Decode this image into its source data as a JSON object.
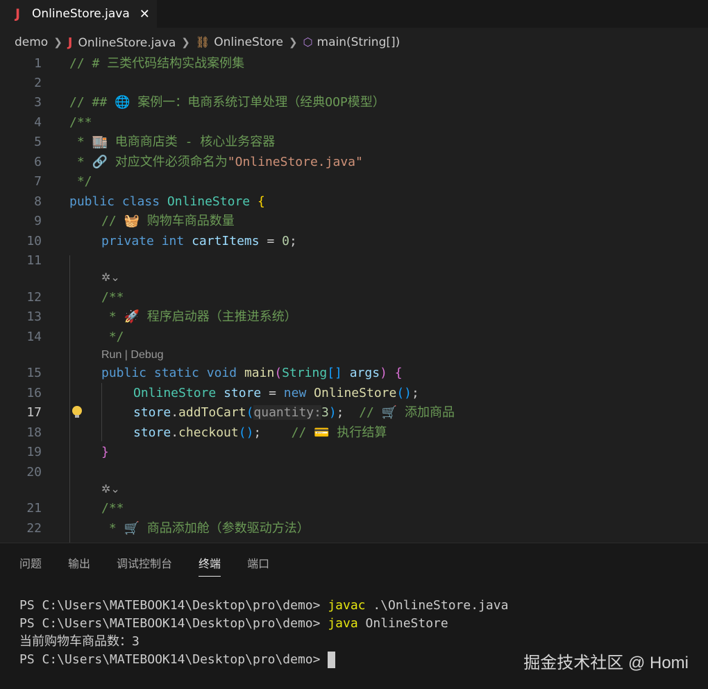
{
  "tab": {
    "icon": "J",
    "name": "OnlineStore.java",
    "close": "✕"
  },
  "breadcrumb": {
    "folder": "demo",
    "file": "OnlineStore.java",
    "class": "OnlineStore",
    "method": "main(String[])"
  },
  "lines": {
    "l1": {
      "num": "1",
      "comment": "// # 三类代码结构实战案例集"
    },
    "l2": {
      "num": "2"
    },
    "l3": {
      "num": "3",
      "comment": "// ## 🌐 案例一：电商系统订单处理（经典OOP模型）"
    },
    "l4": {
      "num": "4",
      "comment": "/**"
    },
    "l5": {
      "num": "5",
      "comment": " * 🏬 电商商店类 - 核心业务容器"
    },
    "l6": {
      "num": "6",
      "comment_a": " * 🔗 对应文件必须命名为",
      "comment_b": "\"OnlineStore.java\""
    },
    "l7": {
      "num": "7",
      "comment": " */"
    },
    "l8": {
      "num": "8",
      "kw1": "public",
      "kw2": "class",
      "cls": "OnlineStore",
      "brace": "{"
    },
    "l9": {
      "num": "9",
      "comment": "// 🧺 购物车商品数量"
    },
    "l10": {
      "num": "10",
      "kw1": "private",
      "kw2": "int",
      "var": "cartItems",
      "op": " = ",
      "val": "0",
      "end": ";"
    },
    "l11": {
      "num": "11"
    },
    "l12": {
      "num": "12",
      "comment": "/**"
    },
    "l13": {
      "num": "13",
      "comment": " * 🚀 程序启动器（主推进系统）"
    },
    "l14": {
      "num": "14",
      "comment": " */"
    },
    "lens": "Run | Debug",
    "l15": {
      "num": "15",
      "kw1": "public",
      "kw2": "static",
      "kw3": "void",
      "fn": "main",
      "p1": "(",
      "type": "String",
      "arr": "[]",
      "arg": "args",
      "p2": ")",
      "brace": "{"
    },
    "l16": {
      "num": "16",
      "type": "OnlineStore",
      "var": "store",
      "op": " = ",
      "kw": "new",
      "cls": "OnlineStore",
      "paren": "()",
      "end": ";"
    },
    "l17": {
      "num": "17",
      "var": "store",
      "dot": ".",
      "fn": "addToCart",
      "p1": "(",
      "hint": "quantity:",
      "val": "3",
      "p2": ")",
      "end": ";",
      "comment": "// 🛒 添加商品"
    },
    "l18": {
      "num": "18",
      "var": "store",
      "dot": ".",
      "fn": "checkout",
      "paren": "()",
      "end": ";",
      "comment": "// 💳 执行结算"
    },
    "l19": {
      "num": "19",
      "brace": "}"
    },
    "l20": {
      "num": "20"
    },
    "l21": {
      "num": "21",
      "comment": "/**"
    },
    "l22": {
      "num": "22",
      "comment": " * 🛒 商品添加舱（参数驱动方法）"
    }
  },
  "panel": {
    "tabs": [
      "问题",
      "输出",
      "调试控制台",
      "终端",
      "端口"
    ],
    "active_tab": "终端",
    "terminal": {
      "prompt": "PS C:\\Users\\MATEBOOK14\\Desktop\\pro\\demo> ",
      "cmd1_a": "javac",
      "cmd1_b": " .\\OnlineStore.java",
      "cmd2_a": "java",
      "cmd2_b": " OnlineStore",
      "output": "当前购物车商品数：3"
    },
    "watermark": "掘金技术社区 @ Homi"
  }
}
